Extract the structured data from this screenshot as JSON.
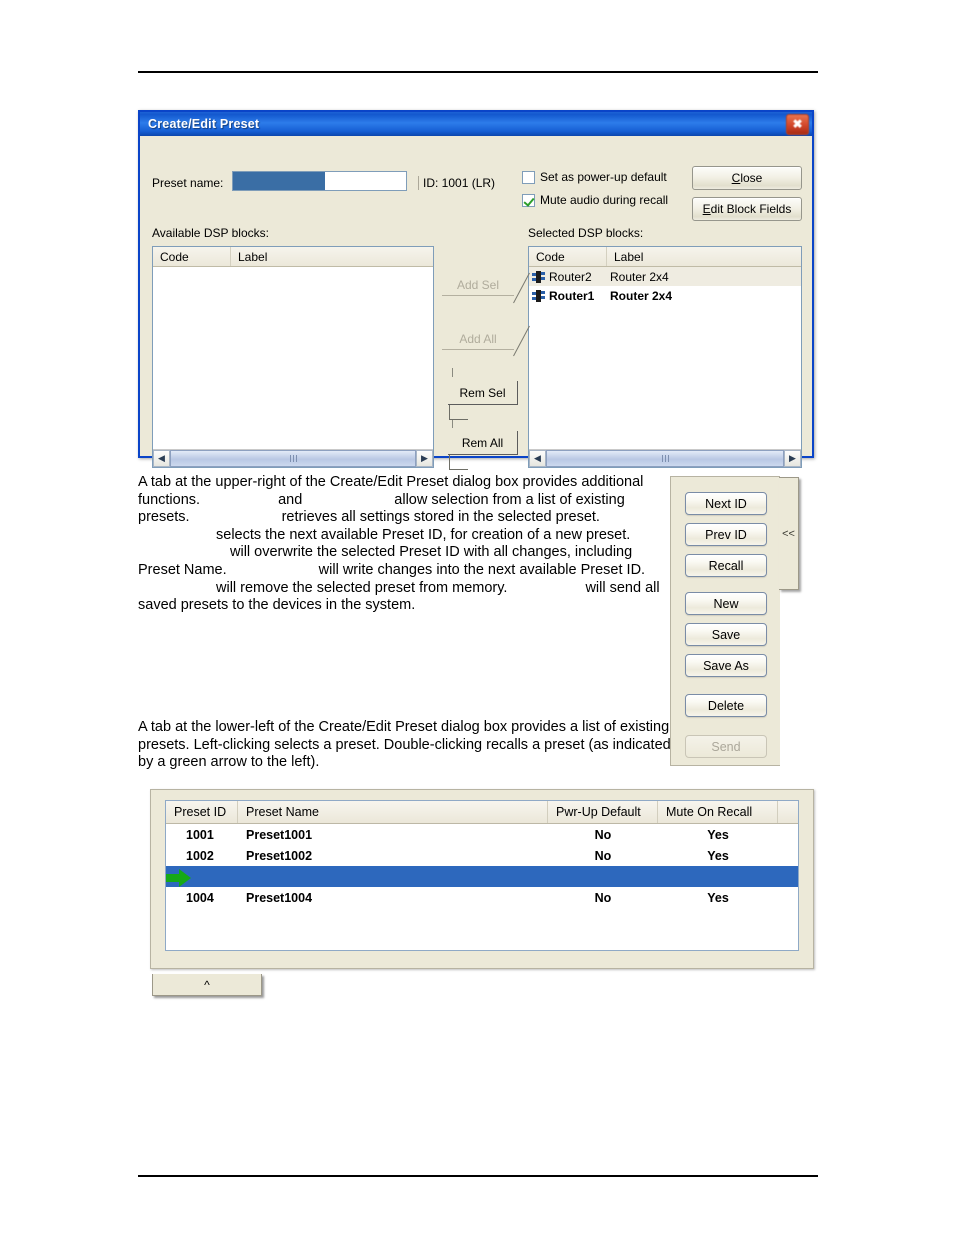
{
  "dialog": {
    "title": "Create/Edit Preset",
    "close_icon": "close-x-icon",
    "preset_name_label": "Preset name:",
    "preset_name_value": "",
    "preset_id_text": "ID: 1001 (LR)",
    "checkbox_powerup": {
      "label": "Set as power-up default",
      "checked": false
    },
    "checkbox_mute": {
      "label": "Mute audio during recall",
      "checked": true
    },
    "close_button": "Close",
    "edit_block_fields_button": "Edit Block Fields",
    "available_caption": "Available DSP blocks:",
    "selected_caption": "Selected DSP blocks:",
    "columns": {
      "code": "Code",
      "label": "Label"
    },
    "available_rows": [],
    "selected_rows": [
      {
        "code": "Router2",
        "label": "Router 2x4",
        "bold": false
      },
      {
        "code": "Router1",
        "label": "Router 2x4",
        "bold": true
      }
    ],
    "transfer_buttons": [
      {
        "label": "Add Sel",
        "enabled": false
      },
      {
        "label": "Add All",
        "enabled": false
      },
      {
        "label": "Rem Sel",
        "enabled": true
      },
      {
        "label": "Rem All",
        "enabled": true
      }
    ],
    "scroll_left_icon": "chevron-left-icon",
    "scroll_right_icon": "chevron-right-icon"
  },
  "body": {
    "paragraph1_part1": "A tab at the upper-right of the Create/Edit Preset dialog box provides additional functions.",
    "paragraph1_part2": "and",
    "paragraph1_part3": "allow selection from a list of existing presets.",
    "paragraph1_part4": "retrieves all settings stored in the selected preset.",
    "paragraph1_part5": "selects the next available Preset ID, for creation of a new preset.",
    "paragraph1_part6": "will overwrite the selected Preset ID with all changes, including Preset Name.",
    "paragraph1_part7": "will write changes into the next available Preset ID.",
    "paragraph1_part8": "will remove the selected preset from memory.",
    "paragraph1_part9": "will send all saved presets to the devices in the system.",
    "paragraph2": "A tab at the lower-left of the Create/Edit Preset dialog box provides a list of existing presets. Left-clicking selects a preset. Double-clicking recalls a preset (as indicated by a green arrow to the left)."
  },
  "button_panel": {
    "buttons": [
      {
        "label": "Next ID",
        "enabled": true
      },
      {
        "label": "Prev ID",
        "enabled": true
      },
      {
        "label": "Recall",
        "enabled": true
      },
      {
        "label": "New",
        "enabled": true
      },
      {
        "label": "Save",
        "enabled": true
      },
      {
        "label": "Save As",
        "enabled": true
      },
      {
        "label": "Delete",
        "enabled": true
      },
      {
        "label": "Send",
        "enabled": false
      }
    ],
    "collapse_tab_label": "<<"
  },
  "preset_table": {
    "headers": [
      "Preset ID",
      "Preset Name",
      "Pwr-Up Default",
      "Mute On Recall"
    ],
    "rows": [
      {
        "id": "1001",
        "name": "Preset1001",
        "pwr": "No",
        "mute": "Yes",
        "selected": false
      },
      {
        "id": "1002",
        "name": "Preset1002",
        "pwr": "No",
        "mute": "Yes",
        "selected": false
      },
      {
        "id": "",
        "name": "",
        "pwr": "",
        "mute": "",
        "selected": true
      },
      {
        "id": "1004",
        "name": "Preset1004",
        "pwr": "No",
        "mute": "Yes",
        "selected": false
      }
    ],
    "recall_arrow_icon": "green-arrow-icon",
    "tab_label": "^"
  },
  "colors": {
    "titlebar_blue": "#1d63d6",
    "selection_blue": "#2d68bd",
    "dialog_face": "#ece9d8",
    "green_arrow": "#16a916",
    "close_red": "#d2462a"
  }
}
